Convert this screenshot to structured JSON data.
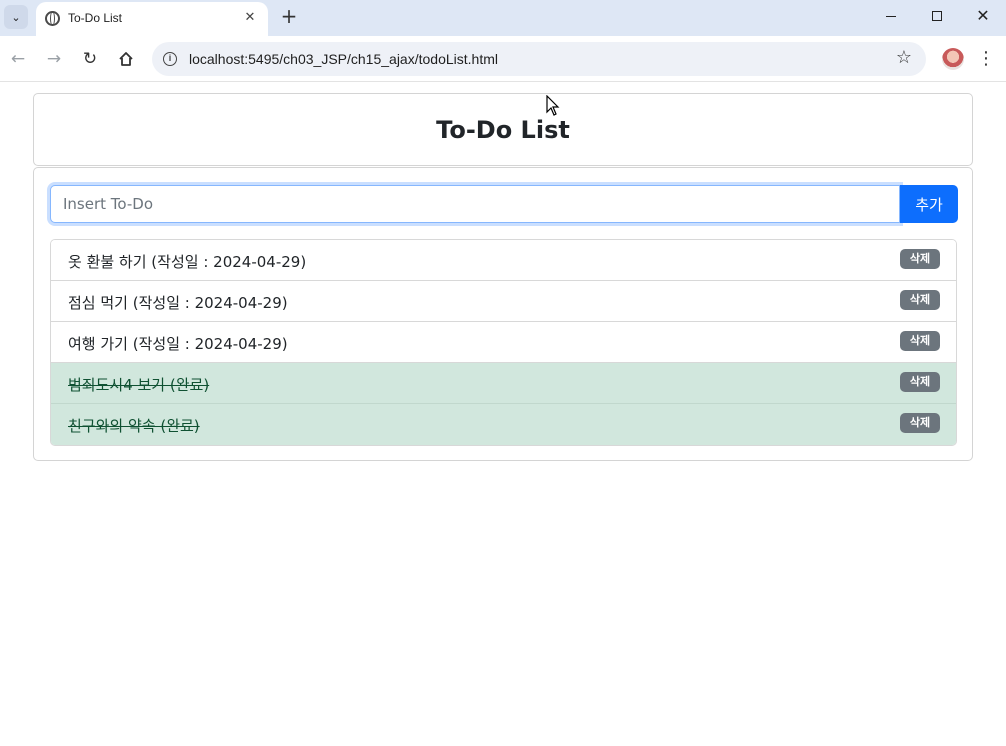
{
  "browser": {
    "tab_title": "To-Do List",
    "tab_close": "✕",
    "new_tab": "+",
    "url": "localhost:5495/ch03_JSP/ch15_ajax/todoList.html"
  },
  "page": {
    "heading": "To-Do List",
    "input_placeholder": "Insert To-Do",
    "input_value": "",
    "add_label": "추가",
    "delete_label": "삭제",
    "todos": [
      {
        "text": "옷 환불 하기 (작성일 : 2024-04-29)",
        "done": false
      },
      {
        "text": "점심 먹기 (작성일 : 2024-04-29)",
        "done": false
      },
      {
        "text": "여행 가기 (작성일 : 2024-04-29)",
        "done": false
      },
      {
        "text": "범죄도시4 보기 (완료)",
        "done": true
      },
      {
        "text": "친구와의 약속 (완료)",
        "done": true
      }
    ]
  },
  "colors": {
    "primary": "#0d6efd",
    "done_bg": "#d1e7dd",
    "done_text": "#0f5132",
    "badge_bg": "#6c757d"
  }
}
